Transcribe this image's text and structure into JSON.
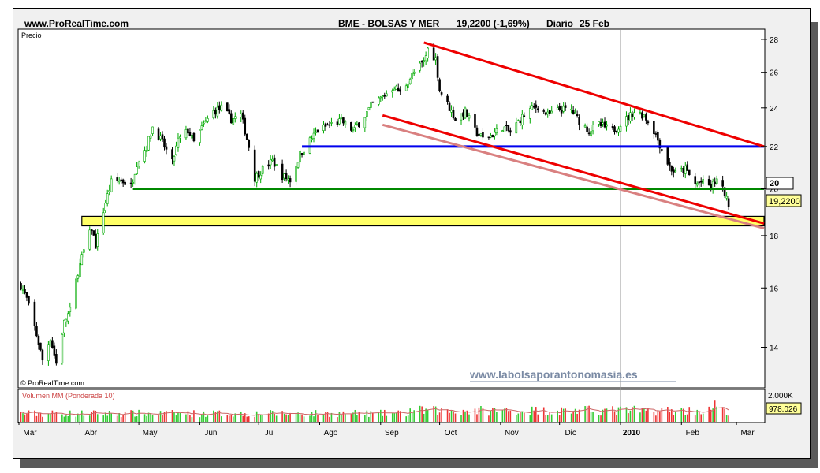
{
  "header": {
    "site": "www.ProRealTime.com",
    "instrument": "BME - BOLSAS Y MER",
    "quote": "19,2200 (-1,69%)",
    "period": "Diario",
    "date": "25 Feb"
  },
  "price_panel": {
    "label": "Precio",
    "copyright": "© ProRealTime.com",
    "watermark": "www.labolsaporantonomasia.es",
    "last_price_tag": "19,2200",
    "highlight_level_tag": "20",
    "y_ticks": [
      "28",
      "26",
      "24",
      "22",
      "20",
      "18",
      "16",
      "14"
    ]
  },
  "volume_panel": {
    "label": "Volumen MM (Ponderada 10)",
    "top_tick": "2.000K",
    "last_volume_tag": "978.026"
  },
  "x_axis": {
    "labels": [
      "Mar",
      "Abr",
      "May",
      "Jun",
      "Jul",
      "Ago",
      "Sep",
      "Oct",
      "Nov",
      "Dic",
      "2010",
      "Feb",
      "Mar"
    ]
  },
  "colors": {
    "up_candle": "#00aa00",
    "down_candle": "#000000",
    "resistance_channel": "#ee0000",
    "support_channel": "#ee0000",
    "shadow_channel": "#d98080",
    "blue_level": "#0000ee",
    "green_level": "#008800",
    "support_zone": "#ffff66",
    "volume_up": "#33cc33",
    "volume_down": "#ee3333",
    "volume_ma": "#cc6666"
  },
  "chart_data": {
    "type": "candlestick",
    "x_axis": "date",
    "y_scale": "log",
    "ylim": [
      12.8,
      28.6
    ],
    "volume_ylim": [
      0,
      2000000
    ],
    "price_anchors": [
      [
        "2009-03-02",
        16.1
      ],
      [
        "2009-03-05",
        15.6
      ],
      [
        "2009-03-10",
        14.4
      ],
      [
        "2009-03-13",
        13.6
      ],
      [
        "2009-03-17",
        14.3
      ],
      [
        "2009-03-20",
        13.5
      ],
      [
        "2009-03-24",
        14.8
      ],
      [
        "2009-03-27",
        15.2
      ],
      [
        "2009-03-31",
        16.6
      ],
      [
        "2009-04-03",
        17.4
      ],
      [
        "2009-04-07",
        18.3
      ],
      [
        "2009-04-09",
        17.6
      ],
      [
        "2009-04-14",
        19.4
      ],
      [
        "2009-04-17",
        20.3
      ],
      [
        "2009-04-22",
        20.4
      ],
      [
        "2009-04-27",
        20.1
      ],
      [
        "2009-04-30",
        21.2
      ],
      [
        "2009-05-05",
        22.0
      ],
      [
        "2009-05-08",
        23.0
      ],
      [
        "2009-05-13",
        22.2
      ],
      [
        "2009-05-18",
        21.2
      ],
      [
        "2009-05-21",
        22.3
      ],
      [
        "2009-05-26",
        22.8
      ],
      [
        "2009-05-29",
        22.2
      ],
      [
        "2009-06-03",
        23.1
      ],
      [
        "2009-06-08",
        23.8
      ],
      [
        "2009-06-12",
        24.0
      ],
      [
        "2009-06-17",
        23.4
      ],
      [
        "2009-06-22",
        23.6
      ],
      [
        "2009-06-26",
        22.0
      ],
      [
        "2009-06-29",
        20.5
      ],
      [
        "2009-07-03",
        20.9
      ],
      [
        "2009-07-08",
        21.3
      ],
      [
        "2009-07-13",
        20.6
      ],
      [
        "2009-07-17",
        20.4
      ],
      [
        "2009-07-22",
        21.6
      ],
      [
        "2009-07-27",
        22.3
      ],
      [
        "2009-07-31",
        22.8
      ],
      [
        "2009-08-06",
        23.1
      ],
      [
        "2009-08-12",
        23.3
      ],
      [
        "2009-08-18",
        22.8
      ],
      [
        "2009-08-24",
        23.6
      ],
      [
        "2009-08-28",
        24.2
      ],
      [
        "2009-09-02",
        24.6
      ],
      [
        "2009-09-08",
        25.2
      ],
      [
        "2009-09-11",
        24.8
      ],
      [
        "2009-09-15",
        25.5
      ],
      [
        "2009-09-18",
        26.0
      ],
      [
        "2009-09-23",
        26.6
      ],
      [
        "2009-09-25",
        27.4
      ],
      [
        "2009-09-29",
        26.8
      ],
      [
        "2009-10-01",
        25.0
      ],
      [
        "2009-10-06",
        24.0
      ],
      [
        "2009-10-09",
        23.4
      ],
      [
        "2009-10-14",
        23.8
      ],
      [
        "2009-10-19",
        22.8
      ],
      [
        "2009-10-23",
        22.4
      ],
      [
        "2009-10-28",
        22.6
      ],
      [
        "2009-11-02",
        23.0
      ],
      [
        "2009-11-06",
        22.7
      ],
      [
        "2009-11-11",
        23.4
      ],
      [
        "2009-11-16",
        23.9
      ],
      [
        "2009-11-20",
        24.1
      ],
      [
        "2009-11-25",
        23.6
      ],
      [
        "2009-12-01",
        23.9
      ],
      [
        "2009-12-07",
        23.9
      ],
      [
        "2009-12-11",
        23.3
      ],
      [
        "2009-12-16",
        22.8
      ],
      [
        "2009-12-21",
        23.1
      ],
      [
        "2009-12-28",
        22.8
      ],
      [
        "2010-01-04",
        23.4
      ],
      [
        "2010-01-08",
        23.8
      ],
      [
        "2010-01-13",
        23.6
      ],
      [
        "2010-01-18",
        22.8
      ],
      [
        "2010-01-21",
        22.1
      ],
      [
        "2010-01-26",
        21.0
      ],
      [
        "2010-01-29",
        20.7
      ],
      [
        "2010-02-03",
        20.9
      ],
      [
        "2010-02-08",
        20.2
      ],
      [
        "2010-02-11",
        20.3
      ],
      [
        "2010-02-16",
        20.1
      ],
      [
        "2010-02-19",
        20.4
      ],
      [
        "2010-02-23",
        19.8
      ],
      [
        "2010-02-25",
        19.22
      ]
    ],
    "levels": [
      {
        "name": "blue",
        "value": 22.0,
        "from": "2009-07-23",
        "to": "2010-03-15"
      },
      {
        "name": "green",
        "value": 20.0,
        "from": "2009-04-28",
        "to": "2010-03-15"
      }
    ],
    "support_zone": {
      "low": 18.4,
      "high": 18.8,
      "from": "2009-04-02",
      "to": "2010-03-15"
    },
    "trendlines": [
      {
        "name": "upper-channel",
        "from": [
          "2009-09-23",
          27.8
        ],
        "to": [
          "2010-03-15",
          22.0
        ]
      },
      {
        "name": "lower-channel",
        "from": [
          "2009-09-02",
          23.6
        ],
        "to": [
          "2010-03-15",
          18.5
        ]
      },
      {
        "name": "shadow-channel",
        "from": [
          "2009-09-02",
          23.1
        ],
        "to": [
          "2010-03-15",
          18.3
        ]
      }
    ]
  }
}
